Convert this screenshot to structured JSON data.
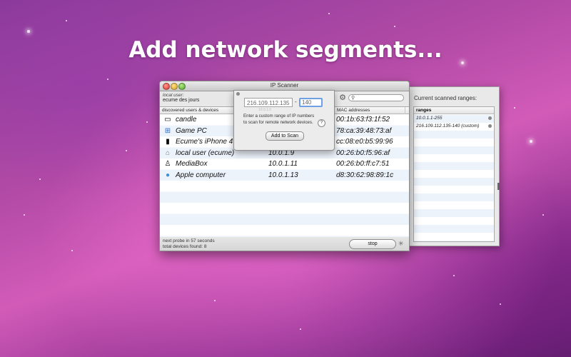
{
  "headline": "Add network segments...",
  "window": {
    "title": "IP Scanner",
    "local_user_label": "local user:",
    "local_user_name": "ecume des jours",
    "search_placeholder": "",
    "columns": [
      "discovered users & devices",
      "",
      "MAC addresses"
    ],
    "devices": [
      {
        "name": "candle",
        "ip": "",
        "mac": "00:1b:63:f3:1f:52",
        "icon": "mac-mini-icon"
      },
      {
        "name": "Game PC",
        "ip": "",
        "mac": "78:ca:39:48:73:af",
        "icon": "windows-icon"
      },
      {
        "name": "Ecume's iPhone 4",
        "ip": "",
        "mac": "cc:08:e0:b5:99:96",
        "icon": "iphone-icon"
      },
      {
        "name": "local user (ecume)",
        "ip": "10.0.1.9",
        "mac": "00:26:b0:f5:96:af",
        "icon": "home-icon"
      },
      {
        "name": "MediaBox",
        "ip": "10.0.1.11",
        "mac": "00:26:b0:ff:c7:51",
        "icon": "linux-icon"
      },
      {
        "name": "Apple computer",
        "ip": "10.0.1.13",
        "mac": "d8:30:62:98:89:1c",
        "icon": "apple-icon"
      }
    ],
    "status_next_probe": "next probe in 57 seconds",
    "status_total": "total devices found: 8",
    "stop_label": "stop"
  },
  "popover": {
    "start_ip": "216.109.112.135",
    "end_ip": "140",
    "dash": "-",
    "hint": "10.0.1.5",
    "help_line1": "Enter a custom range of IP numbers",
    "help_line2": "to scan for remote network devices.",
    "help_icon": "?",
    "add_label": "Add to Scan"
  },
  "drawer": {
    "title": "Current scanned ranges:",
    "column": "ranges",
    "ranges": [
      "10.0.1.1-255",
      "216.109.112.135-140 (custom)"
    ]
  }
}
